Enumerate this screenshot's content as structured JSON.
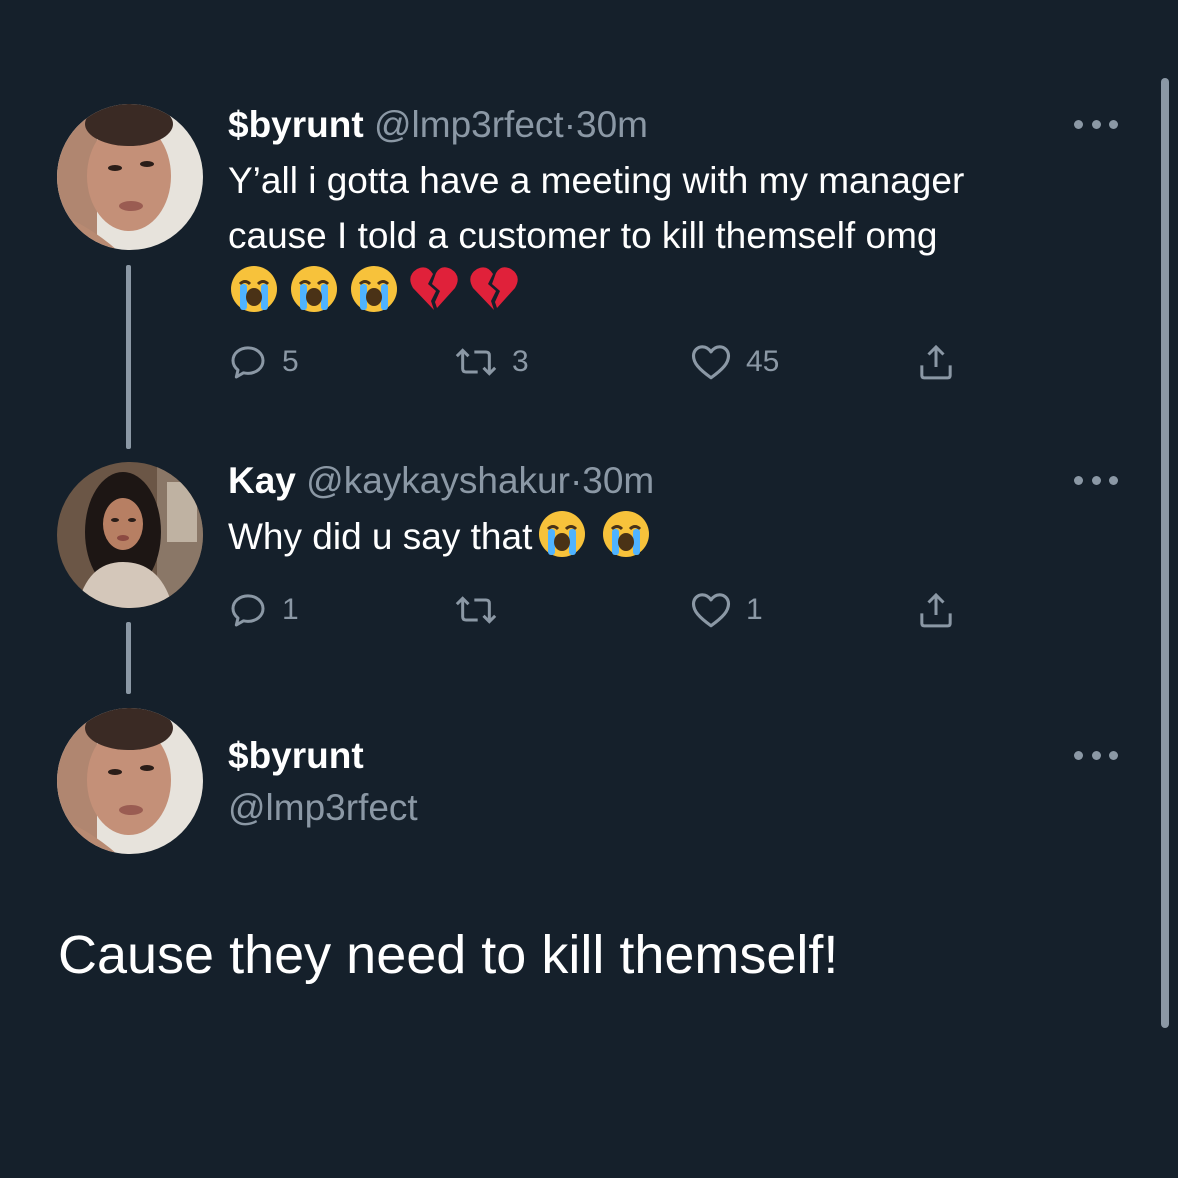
{
  "tweet1": {
    "display_name": "$byrunt",
    "handle": "@lmp3rfect",
    "separator": "·",
    "time": "30m",
    "text_line1": "Y’all i gotta have a meeting with my manager",
    "text_line2": "cause I told a customer to kill themself omg",
    "emojis": [
      "loudly-crying-face",
      "loudly-crying-face",
      "loudly-crying-face",
      "broken-heart",
      "broken-heart"
    ],
    "replies": "5",
    "retweets": "3",
    "likes": "45"
  },
  "tweet2": {
    "display_name": "Kay",
    "handle": "@kaykayshakur",
    "separator": "·",
    "time": "30m",
    "text": "Why did u say that",
    "emojis": [
      "loudly-crying-face",
      "loudly-crying-face"
    ],
    "replies": "1",
    "retweets": "",
    "likes": "1"
  },
  "main_tweet": {
    "display_name": "$byrunt",
    "handle": "@lmp3rfect",
    "text": "Cause they need to kill themself!"
  },
  "colors": {
    "background": "#15202b",
    "text_primary": "#ffffff",
    "text_secondary": "#8b98a5"
  }
}
